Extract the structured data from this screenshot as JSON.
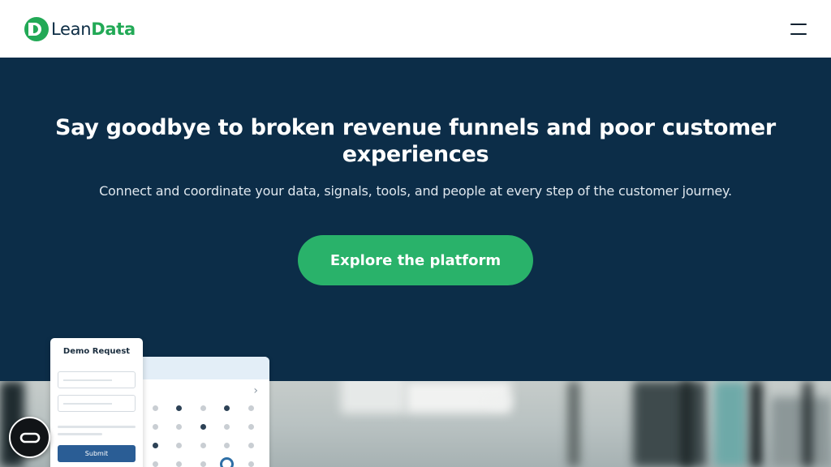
{
  "brand": {
    "name_part1": "Lean",
    "name_part2": "Data",
    "accent_color": "#22a956"
  },
  "header": {
    "menu_icon": "hamburger-menu-icon"
  },
  "hero": {
    "title": "Say goodbye to broken revenue funnels and poor customer experiences",
    "subtitle": "Connect and coordinate your data, signals, tools, and people at every step of the customer journey.",
    "cta_label": "Explore the platform",
    "background_color": "#0c2d48",
    "cta_color": "#29b26a"
  },
  "demo_form": {
    "title": "Demo Request",
    "submit_label": "Submit"
  },
  "calendar": {
    "next_icon": "chevron-right-icon"
  },
  "floating_button": {
    "icon": "chat-loop-icon"
  }
}
